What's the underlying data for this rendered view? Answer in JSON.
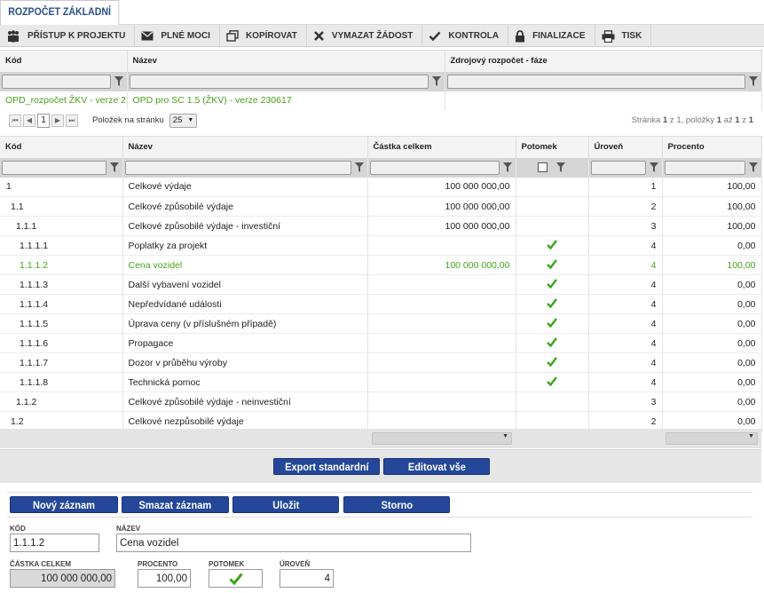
{
  "tab": {
    "title": "ROZPOČET ZÁKLADNÍ"
  },
  "toolbar": {
    "items": [
      {
        "label": "PŘÍSTUP K PROJEKTU",
        "icon": "people-icon"
      },
      {
        "label": "PLNÉ MOCI",
        "icon": "envelope-icon"
      },
      {
        "label": "KOPÍROVAT",
        "icon": "copy-icon"
      },
      {
        "label": "VYMAZAT ŽÁDOST",
        "icon": "delete-x-icon"
      },
      {
        "label": "KONTROLA",
        "icon": "check-icon"
      },
      {
        "label": "FINALIZACE",
        "icon": "lock-icon"
      },
      {
        "label": "TISK",
        "icon": "printer-icon"
      }
    ]
  },
  "budget_table": {
    "headers": {
      "kod": "Kód",
      "nazev": "Název",
      "zdroj": "Zdrojový rozpočet - fáze"
    },
    "row": {
      "kod": "OPD_rozpočet ŽKV - verze 2...",
      "nazev": "OPD pro SC 1.5 (ŽKV) - verze 230617",
      "zdroj": ""
    }
  },
  "pager": {
    "first": "⏮",
    "prev": "◀",
    "page": "1",
    "next": "▶",
    "last": "⏭",
    "per_page_label": "Položek na stránku",
    "per_page_value": "25",
    "info_stranka": "Stránka",
    "info_page": "1",
    "info_z": "z",
    "info_pages": "1,",
    "info_polozky": "položky",
    "info_from": "1",
    "info_az": "až",
    "info_to": "1",
    "info_z2": "z",
    "info_total": "1"
  },
  "items_table": {
    "headers": {
      "kod": "Kód",
      "nazev": "Název",
      "castka": "Částka celkem",
      "potomek": "Potomek",
      "uroven": "Úroveň",
      "procento": "Procento"
    },
    "rows": [
      {
        "kod": "1",
        "indent": 0,
        "nazev": "Celkové výdaje",
        "castka": "100 000 000,00",
        "potomek": false,
        "uroven": "1",
        "procento": "100,00",
        "selected": false
      },
      {
        "kod": "1.1",
        "indent": 1,
        "nazev": "Celkové způsobilé výdaje",
        "castka": "100 000 000,00",
        "potomek": false,
        "uroven": "2",
        "procento": "100,00",
        "selected": false
      },
      {
        "kod": "1.1.1",
        "indent": 2,
        "nazev": "Celkové způsobilé výdaje - investiční",
        "castka": "100 000 000,00",
        "potomek": false,
        "uroven": "3",
        "procento": "100,00",
        "selected": false
      },
      {
        "kod": "1.1.1.1",
        "indent": 3,
        "nazev": "Poplatky za projekt",
        "castka": "",
        "potomek": true,
        "uroven": "4",
        "procento": "0,00",
        "selected": false
      },
      {
        "kod": "1.1.1.2",
        "indent": 3,
        "nazev": "Cena vozidel",
        "castka": "100 000 000,00",
        "potomek": true,
        "uroven": "4",
        "procento": "100,00",
        "selected": true
      },
      {
        "kod": "1.1.1.3",
        "indent": 3,
        "nazev": "Další vybavení vozidel",
        "castka": "",
        "potomek": true,
        "uroven": "4",
        "procento": "0,00",
        "selected": false
      },
      {
        "kod": "1.1.1.4",
        "indent": 3,
        "nazev": "Nepředvídané události",
        "castka": "",
        "potomek": true,
        "uroven": "4",
        "procento": "0,00",
        "selected": false
      },
      {
        "kod": "1.1.1.5",
        "indent": 3,
        "nazev": "Úprava ceny (v příslušném případě)",
        "castka": "",
        "potomek": true,
        "uroven": "4",
        "procento": "0,00",
        "selected": false
      },
      {
        "kod": "1.1.1.6",
        "indent": 3,
        "nazev": "Propagace",
        "castka": "",
        "potomek": true,
        "uroven": "4",
        "procento": "0,00",
        "selected": false
      },
      {
        "kod": "1.1.1.7",
        "indent": 3,
        "nazev": "Dozor v průběhu výroby",
        "castka": "",
        "potomek": true,
        "uroven": "4",
        "procento": "0,00",
        "selected": false
      },
      {
        "kod": "1.1.1.8",
        "indent": 3,
        "nazev": "Technická pomoc",
        "castka": "",
        "potomek": true,
        "uroven": "4",
        "procento": "0,00",
        "selected": false
      },
      {
        "kod": "1.1.2",
        "indent": 2,
        "nazev": "Celkové způsobilé výdaje - neinvestiční",
        "castka": "",
        "potomek": false,
        "uroven": "3",
        "procento": "0,00",
        "selected": false
      },
      {
        "kod": "1.2",
        "indent": 1,
        "nazev": "Celkové nezpůsobilé výdaje",
        "castka": "",
        "potomek": false,
        "uroven": "2",
        "procento": "0,00",
        "selected": false
      }
    ]
  },
  "actions": {
    "export": "Export standardní",
    "edit_all": "Editovat vše"
  },
  "form_buttons": {
    "new": "Nový záznam",
    "delete": "Smazat záznam",
    "save": "Uložit",
    "cancel": "Storno"
  },
  "form": {
    "kod_label": "KÓD",
    "kod_value": "1.1.1.2",
    "nazev_label": "NÁZEV",
    "nazev_value": "Cena vozidel",
    "castka_label": "ČÁSTKA CELKEM",
    "castka_value": "100 000 000,00",
    "procento_label": "PROCENTO",
    "procento_value": "100,00",
    "potomek_label": "POTOMEK",
    "potomek_checked": true,
    "uroven_label": "ÚROVEŇ",
    "uroven_value": "4"
  },
  "colors": {
    "accent": "#24479a",
    "selected_text": "#46a21b",
    "check": "#3aa51a"
  }
}
